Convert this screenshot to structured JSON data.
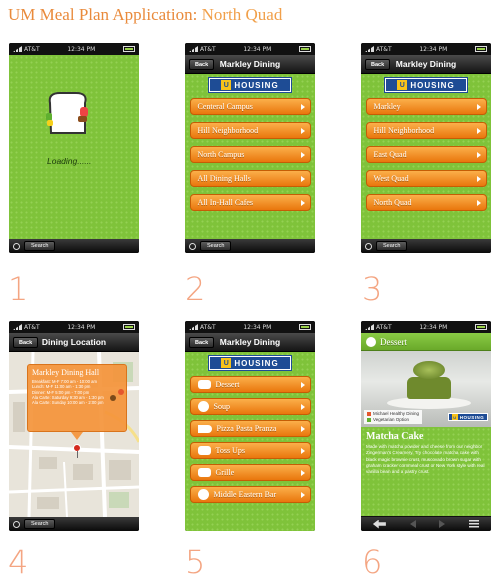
{
  "page": {
    "title_main": "UM Meal Plan Application:",
    "title_sub": "North Quad"
  },
  "status": {
    "carrier": "AT&T",
    "time": "12:34 PM"
  },
  "common": {
    "back_label": "Back",
    "search_label": "Search",
    "logo_u": "U",
    "logo_text": "HOUSING"
  },
  "steps": [
    "1",
    "2",
    "3",
    "4",
    "5",
    "6"
  ],
  "screen1": {
    "loading_text": "Loading......"
  },
  "screen2": {
    "nav_title": "Markley Dining",
    "items": [
      "Centeral Campus",
      "Hill Neighborhood",
      "North Campus",
      "All Dining Halls",
      "All In-Hall Cafes"
    ]
  },
  "screen3": {
    "nav_title": "Markley Dining",
    "items": [
      "Markley",
      "Hill Neighborhood",
      "East Quad",
      "West Quad",
      "North Quad"
    ]
  },
  "screen4": {
    "nav_title": "Dining Location",
    "callout_title": "Markley Dining Hall",
    "hours": [
      "Breakfast: M-F 7:00 am - 10:00 am",
      "Lunch: M-F 11:00 am - 1:30 pm",
      "Dinner: M-F 5:00 pm - 7:00 pm",
      "Ala Carte: Saturday 9:30 am - 1:30 pm",
      "Ala Carte: Sunday 10:00 am - 2:00 pm"
    ]
  },
  "screen5": {
    "nav_title": "Markley Dining",
    "items": [
      "Dessert",
      "Soup",
      "Pizza Pasta Pranza",
      "Toss Ups",
      "Grille",
      "Middle Eastern Bar"
    ]
  },
  "screen6": {
    "header": "Dessert",
    "legend": [
      "Michael Healthy Dining",
      "Vegetarian Option"
    ],
    "food_title": "Matcha Cake",
    "food_desc": "Made with matcha powder and cheese from our neighbor Zingerman's Creamery. Try chocolate matcha cake with black magic brownie crust, muscovado brown sugar with graham cracker cornmeal crust or New York style with real vanilla bean and a pastry crust."
  },
  "colors": {
    "accent": "#e98a3b",
    "screen_green": "#7fc33a",
    "button_orange": "#f49532",
    "housing_blue": "#1e4c95",
    "step_number": "#f4a582"
  }
}
